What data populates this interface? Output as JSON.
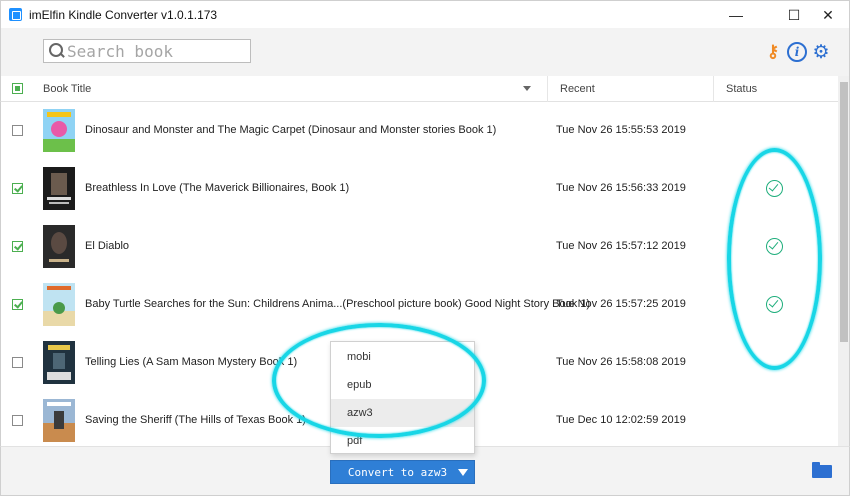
{
  "window": {
    "title": "imElfin Kindle Converter v1.0.1.173",
    "minimize_glyph": "—",
    "maximize_glyph": "☐",
    "close_glyph": "✕"
  },
  "toolbar": {
    "search_placeholder": "Search book",
    "icons": [
      "key-icon",
      "info-icon",
      "gear-icon"
    ],
    "key_glyph": "⚷",
    "info_glyph": "i",
    "gear_glyph": "⚙"
  },
  "table": {
    "columns": {
      "title": "Book Title",
      "recent": "Recent",
      "status": "Status"
    },
    "rows": [
      {
        "checked": false,
        "title": "Dinosaur and Monster and The Magic Carpet (Dinosaur and Monster stories Book 1)",
        "recent": "Tue Nov 26 15:55:53 2019",
        "converted": false
      },
      {
        "checked": true,
        "title": "Breathless In Love (The Maverick Billionaires, Book 1)",
        "recent": "Tue Nov 26 15:56:33 2019",
        "converted": true
      },
      {
        "checked": true,
        "title": "El Diablo",
        "recent": "Tue Nov 26 15:57:12 2019",
        "converted": true
      },
      {
        "checked": true,
        "title": "Baby Turtle Searches for the Sun: Childrens Anima...(Preschool picture book) Good Night Story Book 1)",
        "recent": "Tue Nov 26 15:57:25 2019",
        "converted": true
      },
      {
        "checked": false,
        "title": "Telling Lies (A Sam Mason Mystery Book 1)",
        "recent": "Tue Nov 26 15:58:08 2019",
        "converted": false
      },
      {
        "checked": false,
        "title": "Saving the Sheriff (The Hills of Texas Book 1)",
        "recent": "Tue Dec 10 12:02:59 2019",
        "converted": false
      }
    ]
  },
  "format_menu": {
    "options": [
      "mobi",
      "epub",
      "azw3",
      "pdf"
    ],
    "highlighted": "azw3"
  },
  "footer": {
    "convert_label": "Convert to azw3"
  },
  "colors": {
    "accent": "#2f7fd6",
    "status_ok": "#1fae7c",
    "checkbox": "#4caf50",
    "annotation": "#18d6e6",
    "key": "#f08a24"
  }
}
